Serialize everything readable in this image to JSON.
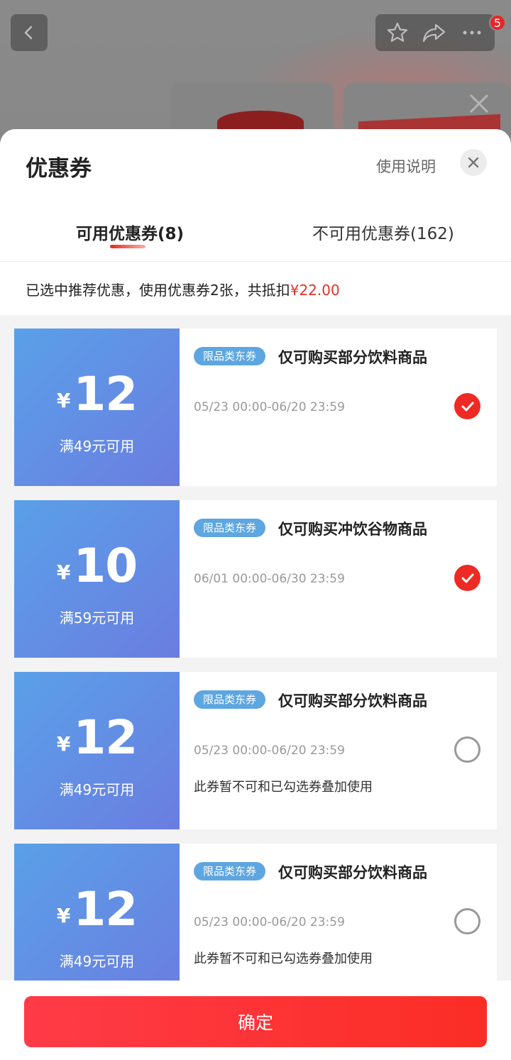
{
  "top_bar": {
    "cart_badge": "5",
    "icons": [
      "back-icon",
      "star-icon",
      "share-icon",
      "more-icon",
      "close-icon"
    ]
  },
  "sheet": {
    "title": "优惠券",
    "help_link": "使用说明",
    "tabs": [
      {
        "label": "可用优惠券(8)",
        "active": true
      },
      {
        "label": "不可用优惠券(162)",
        "active": false
      }
    ],
    "summary": {
      "text": "已选中推荐优惠，使用优惠券2张，共抵扣",
      "amount": "¥22.00"
    }
  },
  "coupons": [
    {
      "currency": "¥",
      "amount": "12",
      "threshold": "满49元可用",
      "tag": "限品类东券",
      "scope": "仅可购买部分饮料商品",
      "period": "05/23 00:00-06/20 23:59",
      "note": "",
      "selected": true
    },
    {
      "currency": "¥",
      "amount": "10",
      "threshold": "满59元可用",
      "tag": "限品类东券",
      "scope": "仅可购买冲饮谷物商品",
      "period": "06/01 00:00-06/30 23:59",
      "note": "",
      "selected": true
    },
    {
      "currency": "¥",
      "amount": "12",
      "threshold": "满49元可用",
      "tag": "限品类东券",
      "scope": "仅可购买部分饮料商品",
      "period": "05/23 00:00-06/20 23:59",
      "note": "此券暂不可和已勾选券叠加使用",
      "selected": false
    },
    {
      "currency": "¥",
      "amount": "12",
      "threshold": "满49元可用",
      "tag": "限品类东券",
      "scope": "仅可购买部分饮料商品",
      "period": "05/23 00:00-06/20 23:59",
      "note": "此券暂不可和已勾选券叠加使用",
      "selected": false
    }
  ],
  "footer": {
    "confirm_label": "确定"
  },
  "colors": {
    "accent_red": "#ee2a24",
    "coupon_blue_start": "#5aa0e8",
    "coupon_blue_end": "#6b7de0",
    "tag_blue": "#5ea6e0"
  }
}
